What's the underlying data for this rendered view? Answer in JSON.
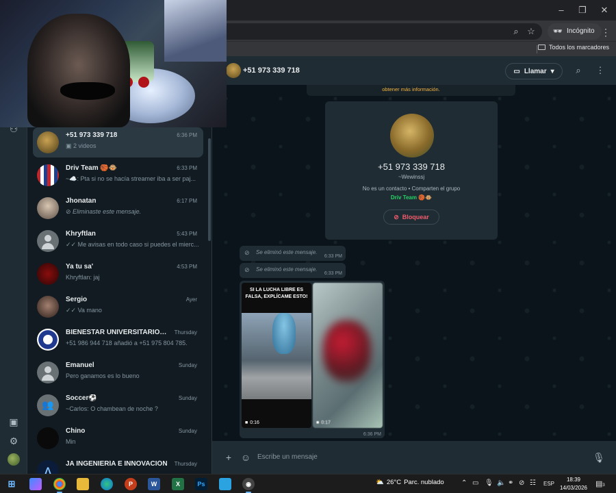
{
  "browser": {
    "window_controls": {
      "minimize": "–",
      "maximize": "❐",
      "close": "✕"
    },
    "incognito_label": "Incógnito",
    "bookmarks_label": "Todos los marcadores"
  },
  "nav": {
    "icons": [
      "community-icon",
      "status-icon",
      "settings-icon"
    ]
  },
  "chats": [
    {
      "name": "+51 973 339 718",
      "time": "6:36 PM",
      "preview": "2 videos",
      "avatar": "photo-gold",
      "selected": true
    },
    {
      "name": "Driv Team 🏀🐵",
      "time": "6:33 PM",
      "preview": "~☁️: Pta si no se hacía streamer iba a ser paj...",
      "avatar": "photo-flag"
    },
    {
      "name": "Jhonatan",
      "time": "6:17 PM",
      "preview": "Eliminaste este mensaje.",
      "avatar": "photo-person",
      "deleted": true
    },
    {
      "name": "Khryftlan",
      "time": "5:43 PM",
      "preview": "✓✓ Me avisas en todo caso si puedes el mierc...",
      "avatar": "generic"
    },
    {
      "name": "Ya tu sa'",
      "time": "4:53 PM",
      "preview": "Khryftlan: jaj",
      "avatar": "photo-red"
    },
    {
      "name": "Sergio",
      "time": "Ayer",
      "preview": "✓✓ Va mano",
      "avatar": "photo-dark"
    },
    {
      "name": "BIENESTAR UNIVERSITARIO - FA...",
      "time": "Thursday",
      "preview": "+51 986 944 718 añadió a +51 975 804 785.",
      "avatar": "photo-logo"
    },
    {
      "name": "Emanuel",
      "time": "Sunday",
      "preview": "Pero ganamos es lo bueno",
      "avatar": "generic"
    },
    {
      "name": "Soccer⚽",
      "time": "Sunday",
      "preview": "~Carlos: O chambean de noche ?",
      "avatar": "group"
    },
    {
      "name": "Chino",
      "time": "Sunday",
      "preview": "Min",
      "avatar": "photo-black"
    },
    {
      "name": "JA INGENIERÍA E INNOVACIÓN",
      "time": "Thursday",
      "preview": "",
      "avatar": "photo-ja"
    }
  ],
  "conversation": {
    "header_name": "+51 973 339 718",
    "call_label": "Llamar",
    "system_notice": "obtener más información.",
    "contact_card": {
      "phone": "+51 973 339 718",
      "handle": "~Wewinssj",
      "info": "No es un contacto • Comparten el grupo",
      "group": "Driv Team 🏀🐵",
      "block_label": "Bloquear"
    },
    "deleted_messages": [
      {
        "text": "Se eliminó este mensaje.",
        "time": "6:33 PM"
      },
      {
        "text": "Se eliminó este mensaje.",
        "time": "6:33 PM"
      }
    ],
    "media": {
      "video1_caption": "SI LA LUCHA LIBRE ES FALSA, EXPLÍCAME ESTO!",
      "video1_duration": "0:16",
      "video2_duration": "0:17",
      "time": "6:36 PM"
    },
    "composer_placeholder": "Escribe un mensaje"
  },
  "taskbar": {
    "weather_temp": "26°C",
    "weather_desc": "Parc. nublado",
    "language": "ESP",
    "time": "18:39",
    "date": "14/03/2026",
    "notification_count": "3"
  }
}
